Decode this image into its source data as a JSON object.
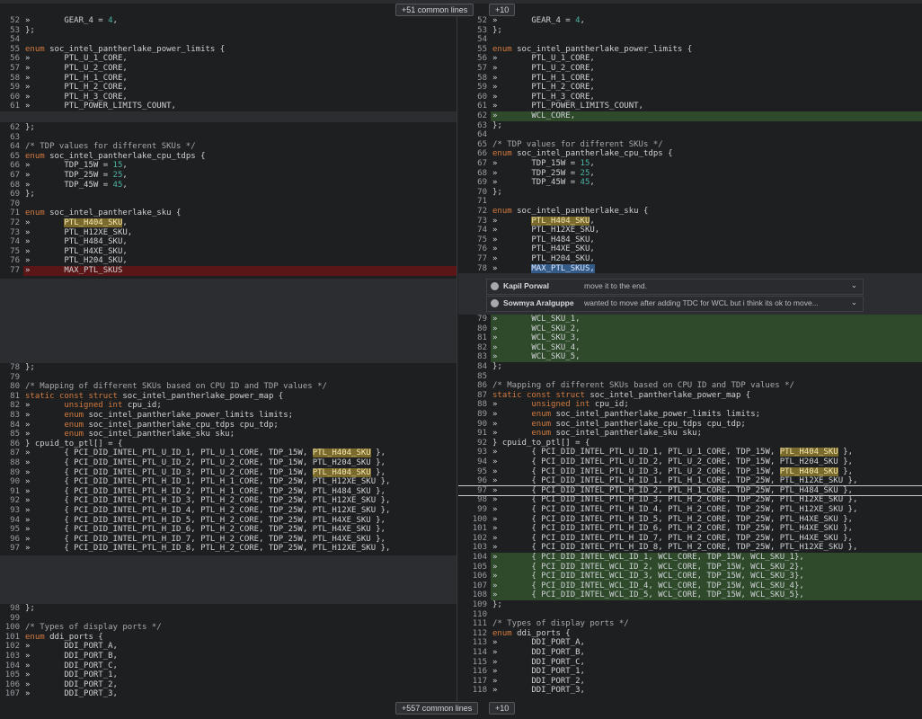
{
  "top_expanders": {
    "common": "+51 common lines",
    "more": "+10"
  },
  "bottom_expanders": {
    "common": "+557 common lines",
    "more": "+10"
  },
  "comments": [
    {
      "author": "Kapil Porwal",
      "text": "move it to the end."
    },
    {
      "author": "Sowmya Aralguppe",
      "text": "wanted to move after adding TDC for WCL but i think its ok to move..."
    }
  ],
  "left": {
    "block1": [
      {
        "n": "52",
        "t": "»       GEAR_4 = 4,"
      },
      {
        "n": "53",
        "t": "};"
      },
      {
        "n": "54",
        "t": ""
      },
      {
        "n": "55",
        "t": "enum soc_intel_pantherlake_power_limits {"
      },
      {
        "n": "56",
        "t": "»       PTL_U_1_CORE,"
      },
      {
        "n": "57",
        "t": "»       PTL_U_2_CORE,"
      },
      {
        "n": "58",
        "t": "»       PTL_H_1_CORE,"
      },
      {
        "n": "59",
        "t": "»       PTL_H_2_CORE,"
      },
      {
        "n": "60",
        "t": "»       PTL_H_3_CORE,"
      },
      {
        "n": "61",
        "t": "»       PTL_POWER_LIMITS_COUNT,"
      }
    ],
    "block2": [
      {
        "n": "62",
        "t": "};"
      },
      {
        "n": "63",
        "t": ""
      },
      {
        "n": "64",
        "t": "/* TDP values for different SKUs */"
      },
      {
        "n": "65",
        "t": "enum soc_intel_pantherlake_cpu_tdps {"
      },
      {
        "n": "66",
        "t": "»       TDP_15W = 15,"
      },
      {
        "n": "67",
        "t": "»       TDP_25W = 25,"
      },
      {
        "n": "68",
        "t": "»       TDP_45W = 45,"
      },
      {
        "n": "69",
        "t": "};"
      },
      {
        "n": "70",
        "t": ""
      },
      {
        "n": "71",
        "t": "enum soc_intel_pantherlake_sku {"
      },
      {
        "n": "72",
        "t": "»       PTL_H404_SKU,"
      },
      {
        "n": "73",
        "t": "»       PTL_H12XE_SKU,"
      },
      {
        "n": "74",
        "t": "»       PTL_H484_SKU,"
      },
      {
        "n": "75",
        "t": "»       PTL_H4XE_SKU,"
      },
      {
        "n": "76",
        "t": "»       PTL_H204_SKU,"
      },
      {
        "n": "77",
        "t": "»       MAX_PTL_SKUS"
      }
    ],
    "block3": [
      {
        "n": "78",
        "t": "};"
      },
      {
        "n": "79",
        "t": ""
      },
      {
        "n": "80",
        "t": "/* Mapping of different SKUs based on CPU ID and TDP values */"
      },
      {
        "n": "81",
        "t": "static const struct soc_intel_pantherlake_power_map {"
      },
      {
        "n": "82",
        "t": "»       unsigned int cpu_id;"
      },
      {
        "n": "83",
        "t": "»       enum soc_intel_pantherlake_power_limits limits;"
      },
      {
        "n": "84",
        "t": "»       enum soc_intel_pantherlake_cpu_tdps cpu_tdp;"
      },
      {
        "n": "85",
        "t": "»       enum soc_intel_pantherlake_sku sku;"
      },
      {
        "n": "86",
        "t": "} cpuid_to_ptl[] = {"
      },
      {
        "n": "87",
        "t": "»       { PCI_DID_INTEL_PTL_U_ID_1, PTL_U_1_CORE, TDP_15W, PTL_H404_SKU },"
      },
      {
        "n": "88",
        "t": "»       { PCI_DID_INTEL_PTL_U_ID_2, PTL_U_2_CORE, TDP_15W, PTL_H204_SKU },"
      },
      {
        "n": "89",
        "t": "»       { PCI_DID_INTEL_PTL_U_ID_3, PTL_U_2_CORE, TDP_15W, PTL_H404_SKU },"
      },
      {
        "n": "90",
        "t": "»       { PCI_DID_INTEL_PTL_H_ID_1, PTL_H_1_CORE, TDP_25W, PTL_H12XE_SKU },"
      },
      {
        "n": "91",
        "t": "»       { PCI_DID_INTEL_PTL_H_ID_2, PTL_H_1_CORE, TDP_25W, PTL_H484_SKU },"
      },
      {
        "n": "92",
        "t": "»       { PCI_DID_INTEL_PTL_H_ID_3, PTL_H_2_CORE, TDP_25W, PTL_H12XE_SKU },"
      },
      {
        "n": "93",
        "t": "»       { PCI_DID_INTEL_PTL_H_ID_4, PTL_H_2_CORE, TDP_25W, PTL_H12XE_SKU },"
      },
      {
        "n": "94",
        "t": "»       { PCI_DID_INTEL_PTL_H_ID_5, PTL_H_2_CORE, TDP_25W, PTL_H4XE_SKU },"
      },
      {
        "n": "95",
        "t": "»       { PCI_DID_INTEL_PTL_H_ID_6, PTL_H_2_CORE, TDP_25W, PTL_H4XE_SKU },"
      },
      {
        "n": "96",
        "t": "»       { PCI_DID_INTEL_PTL_H_ID_7, PTL_H_2_CORE, TDP_25W, PTL_H4XE_SKU },"
      },
      {
        "n": "97",
        "t": "»       { PCI_DID_INTEL_PTL_H_ID_8, PTL_H_2_CORE, TDP_25W, PTL_H12XE_SKU },"
      }
    ],
    "block4": [
      {
        "n": "98",
        "t": "};"
      },
      {
        "n": "99",
        "t": ""
      },
      {
        "n": "100",
        "t": "/* Types of display ports */"
      },
      {
        "n": "101",
        "t": "enum ddi_ports {"
      },
      {
        "n": "102",
        "t": "»       DDI_PORT_A,"
      },
      {
        "n": "103",
        "t": "»       DDI_PORT_B,"
      },
      {
        "n": "104",
        "t": "»       DDI_PORT_C,"
      },
      {
        "n": "105",
        "t": "»       DDI_PORT_1,"
      },
      {
        "n": "106",
        "t": "»       DDI_PORT_2,"
      },
      {
        "n": "107",
        "t": "»       DDI_PORT_3,"
      }
    ]
  },
  "right": {
    "block1": [
      {
        "n": "52",
        "t": "»       GEAR_4 = 4,"
      },
      {
        "n": "53",
        "t": "};"
      },
      {
        "n": "54",
        "t": ""
      },
      {
        "n": "55",
        "t": "enum soc_intel_pantherlake_power_limits {"
      },
      {
        "n": "56",
        "t": "»       PTL_U_1_CORE,"
      },
      {
        "n": "57",
        "t": "»       PTL_U_2_CORE,"
      },
      {
        "n": "58",
        "t": "»       PTL_H_1_CORE,"
      },
      {
        "n": "59",
        "t": "»       PTL_H_2_CORE,"
      },
      {
        "n": "60",
        "t": "»       PTL_H_3_CORE,"
      },
      {
        "n": "61",
        "t": "»       PTL_POWER_LIMITS_COUNT,"
      },
      {
        "n": "62",
        "t": "»       WCL_CORE,"
      },
      {
        "n": "63",
        "t": "};"
      },
      {
        "n": "64",
        "t": ""
      },
      {
        "n": "65",
        "t": "/* TDP values for different SKUs */"
      },
      {
        "n": "66",
        "t": "enum soc_intel_pantherlake_cpu_tdps {"
      },
      {
        "n": "67",
        "t": "»       TDP_15W = 15,"
      },
      {
        "n": "68",
        "t": "»       TDP_25W = 25,"
      },
      {
        "n": "69",
        "t": "»       TDP_45W = 45,"
      },
      {
        "n": "70",
        "t": "};"
      },
      {
        "n": "71",
        "t": ""
      },
      {
        "n": "72",
        "t": "enum soc_intel_pantherlake_sku {"
      },
      {
        "n": "73",
        "t": "»       PTL_H404_SKU,"
      },
      {
        "n": "74",
        "t": "»       PTL_H12XE_SKU,"
      },
      {
        "n": "75",
        "t": "»       PTL_H484_SKU,"
      },
      {
        "n": "76",
        "t": "»       PTL_H4XE_SKU,"
      },
      {
        "n": "77",
        "t": "»       PTL_H204_SKU,"
      },
      {
        "n": "78",
        "t": "»       MAX_PTL_SKUS,"
      }
    ],
    "block2": [
      {
        "n": "79",
        "t": "»       WCL_SKU_1,"
      },
      {
        "n": "80",
        "t": "»       WCL_SKU_2,"
      },
      {
        "n": "81",
        "t": "»       WCL_SKU_3,"
      },
      {
        "n": "82",
        "t": "»       WCL_SKU_4,"
      },
      {
        "n": "83",
        "t": "»       WCL_SKU_5,"
      },
      {
        "n": "84",
        "t": "};"
      },
      {
        "n": "85",
        "t": ""
      },
      {
        "n": "86",
        "t": "/* Mapping of different SKUs based on CPU ID and TDP values */"
      },
      {
        "n": "87",
        "t": "static const struct soc_intel_pantherlake_power_map {"
      },
      {
        "n": "88",
        "t": "»       unsigned int cpu_id;"
      },
      {
        "n": "89",
        "t": "»       enum soc_intel_pantherlake_power_limits limits;"
      },
      {
        "n": "90",
        "t": "»       enum soc_intel_pantherlake_cpu_tdps cpu_tdp;"
      },
      {
        "n": "91",
        "t": "»       enum soc_intel_pantherlake_sku sku;"
      },
      {
        "n": "92",
        "t": "} cpuid_to_ptl[] = {"
      },
      {
        "n": "93",
        "t": "»       { PCI_DID_INTEL_PTL_U_ID_1, PTL_U_1_CORE, TDP_15W, PTL_H404_SKU },"
      },
      {
        "n": "94",
        "t": "»       { PCI_DID_INTEL_PTL_U_ID_2, PTL_U_2_CORE, TDP_15W, PTL_H204_SKU },"
      },
      {
        "n": "95",
        "t": "»       { PCI_DID_INTEL_PTL_U_ID_3, PTL_U_2_CORE, TDP_15W, PTL_H404_SKU },"
      },
      {
        "n": "96",
        "t": "»       { PCI_DID_INTEL_PTL_H_ID_1, PTL_H_1_CORE, TDP_25W, PTL_H12XE_SKU },"
      },
      {
        "n": "97",
        "t": "»       { PCI_DID_INTEL_PTL_H_ID_2, PTL_H_1_CORE, TDP_25W, PTL_H484_SKU },"
      },
      {
        "n": "98",
        "t": "»       { PCI_DID_INTEL_PTL_H_ID_3, PTL_H_2_CORE, TDP_25W, PTL_H12XE_SKU },"
      },
      {
        "n": "99",
        "t": "»       { PCI_DID_INTEL_PTL_H_ID_4, PTL_H_2_CORE, TDP_25W, PTL_H12XE_SKU },"
      },
      {
        "n": "100",
        "t": "»       { PCI_DID_INTEL_PTL_H_ID_5, PTL_H_2_CORE, TDP_25W, PTL_H4XE_SKU },"
      },
      {
        "n": "101",
        "t": "»       { PCI_DID_INTEL_PTL_H_ID_6, PTL_H_2_CORE, TDP_25W, PTL_H4XE_SKU },"
      },
      {
        "n": "102",
        "t": "»       { PCI_DID_INTEL_PTL_H_ID_7, PTL_H_2_CORE, TDP_25W, PTL_H4XE_SKU },"
      },
      {
        "n": "103",
        "t": "»       { PCI_DID_INTEL_PTL_H_ID_8, PTL_H_2_CORE, TDP_25W, PTL_H12XE_SKU },"
      },
      {
        "n": "104",
        "t": "»       { PCI_DID_INTEL_WCL_ID_1, WCL_CORE, TDP_15W, WCL_SKU_1},"
      },
      {
        "n": "105",
        "t": "»       { PCI_DID_INTEL_WCL_ID_2, WCL_CORE, TDP_15W, WCL_SKU_2},"
      },
      {
        "n": "106",
        "t": "»       { PCI_DID_INTEL_WCL_ID_3, WCL_CORE, TDP_15W, WCL_SKU_3},"
      },
      {
        "n": "107",
        "t": "»       { PCI_DID_INTEL_WCL_ID_4, WCL_CORE, TDP_15W, WCL_SKU_4},"
      },
      {
        "n": "108",
        "t": "»       { PCI_DID_INTEL_WCL_ID_5, WCL_CORE, TDP_15W, WCL_SKU_5},"
      },
      {
        "n": "109",
        "t": "};"
      },
      {
        "n": "110",
        "t": ""
      },
      {
        "n": "111",
        "t": "/* Types of display ports */"
      },
      {
        "n": "112",
        "t": "enum ddi_ports {"
      },
      {
        "n": "113",
        "t": "»       DDI_PORT_A,"
      },
      {
        "n": "114",
        "t": "»       DDI_PORT_B,"
      },
      {
        "n": "115",
        "t": "»       DDI_PORT_C,"
      },
      {
        "n": "116",
        "t": "»       DDI_PORT_1,"
      },
      {
        "n": "117",
        "t": "»       DDI_PORT_2,"
      },
      {
        "n": "118",
        "t": "»       DDI_PORT_3,"
      }
    ]
  }
}
